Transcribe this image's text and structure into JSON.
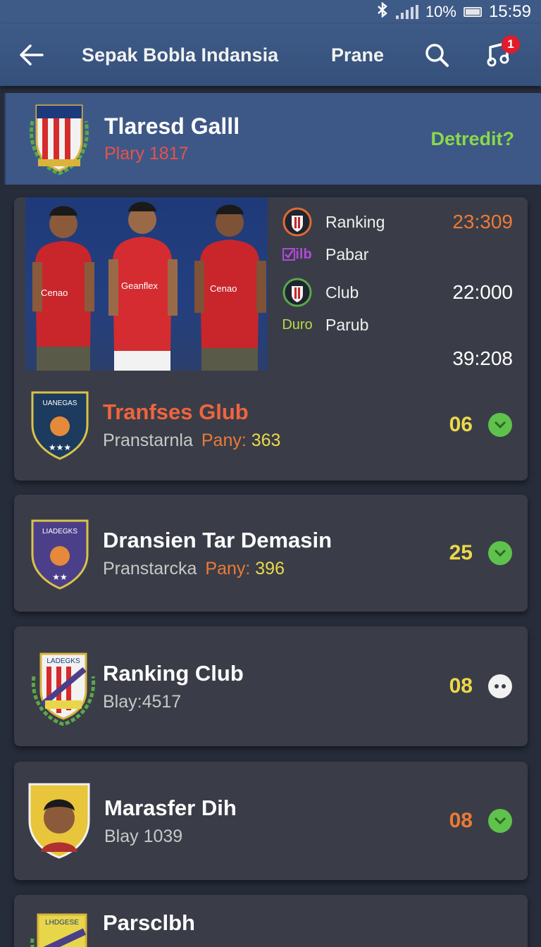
{
  "status_bar": {
    "battery": "10%",
    "time": "15:59",
    "icons": [
      "bluetooth-icon",
      "signal-icon",
      "battery-icon"
    ]
  },
  "app_bar": {
    "title": "Sepak Bobla Indansia",
    "tab": "Prane",
    "notification_count": "1",
    "icons": [
      "back-arrow-icon",
      "search-icon",
      "notification-icon"
    ]
  },
  "featured": {
    "name": "Tlaresd Galll",
    "subtitle": "Plary 1817",
    "action": "Detredit?"
  },
  "hero": {
    "stats": [
      {
        "icon_text": "",
        "icon": "club-crest-icon",
        "label": "Ranking",
        "value": "23:309",
        "color": "#ec7a37"
      },
      {
        "icon_text": "ilb",
        "icon": "check-icon",
        "label": "Pabar",
        "value": "",
        "color": "#b04ad8"
      },
      {
        "icon_text": "",
        "icon": "club-crest-icon",
        "label": "Club",
        "value": "22:000",
        "color": "#ffffff"
      },
      {
        "icon_text": "Duro",
        "icon": "",
        "label": "Parub",
        "value": "",
        "color": "#b9d94a"
      },
      {
        "icon_text": "",
        "icon": "",
        "label": "",
        "value": "39:208",
        "color": "#ffffff"
      }
    ],
    "jersey_text": [
      "Cenao",
      "Geanflex",
      "Cenao"
    ]
  },
  "clubs": [
    {
      "crest_text": "UANEGAS",
      "name": "Tranfses Glub",
      "name_color": "#f0643e",
      "sub": "Pranstarnla",
      "pany_label": "Pany:",
      "pany_value": "363",
      "number": "06",
      "number_color": "#ecd94a",
      "status": "ok"
    },
    {
      "crest_text": "LIADEGKS",
      "name": "Dransien Tar Demasin",
      "name_color": "#ffffff",
      "sub": "Pranstarcka",
      "pany_label": "Pany:",
      "pany_value": "396",
      "number": "25",
      "number_color": "#ecd94a",
      "status": "ok"
    },
    {
      "crest_text": "LADEGKS",
      "name": "Ranking Club",
      "name_color": "#ffffff",
      "sub": "Blay:4517",
      "pany_label": "",
      "pany_value": "",
      "number": "08",
      "number_color": "#ecd94a",
      "status": "more"
    },
    {
      "crest_text": "",
      "name": "Marasfer Dih",
      "name_color": "#ffffff",
      "sub": "Blay 1039",
      "pany_label": "",
      "pany_value": "",
      "number": "08",
      "number_color": "#ec7a37",
      "status": "ok"
    },
    {
      "crest_text": "LHDGESE",
      "name": "Parsclbh",
      "name_color": "#ffffff",
      "sub": "",
      "pany_label": "",
      "pany_value": "",
      "number": "",
      "number_color": "#ecd94a",
      "status": "ok"
    }
  ],
  "colors": {
    "app_bar": "#3e5a86",
    "background": "#262c3a",
    "card": "#3a3d47",
    "accent_green": "#5fc24c"
  }
}
